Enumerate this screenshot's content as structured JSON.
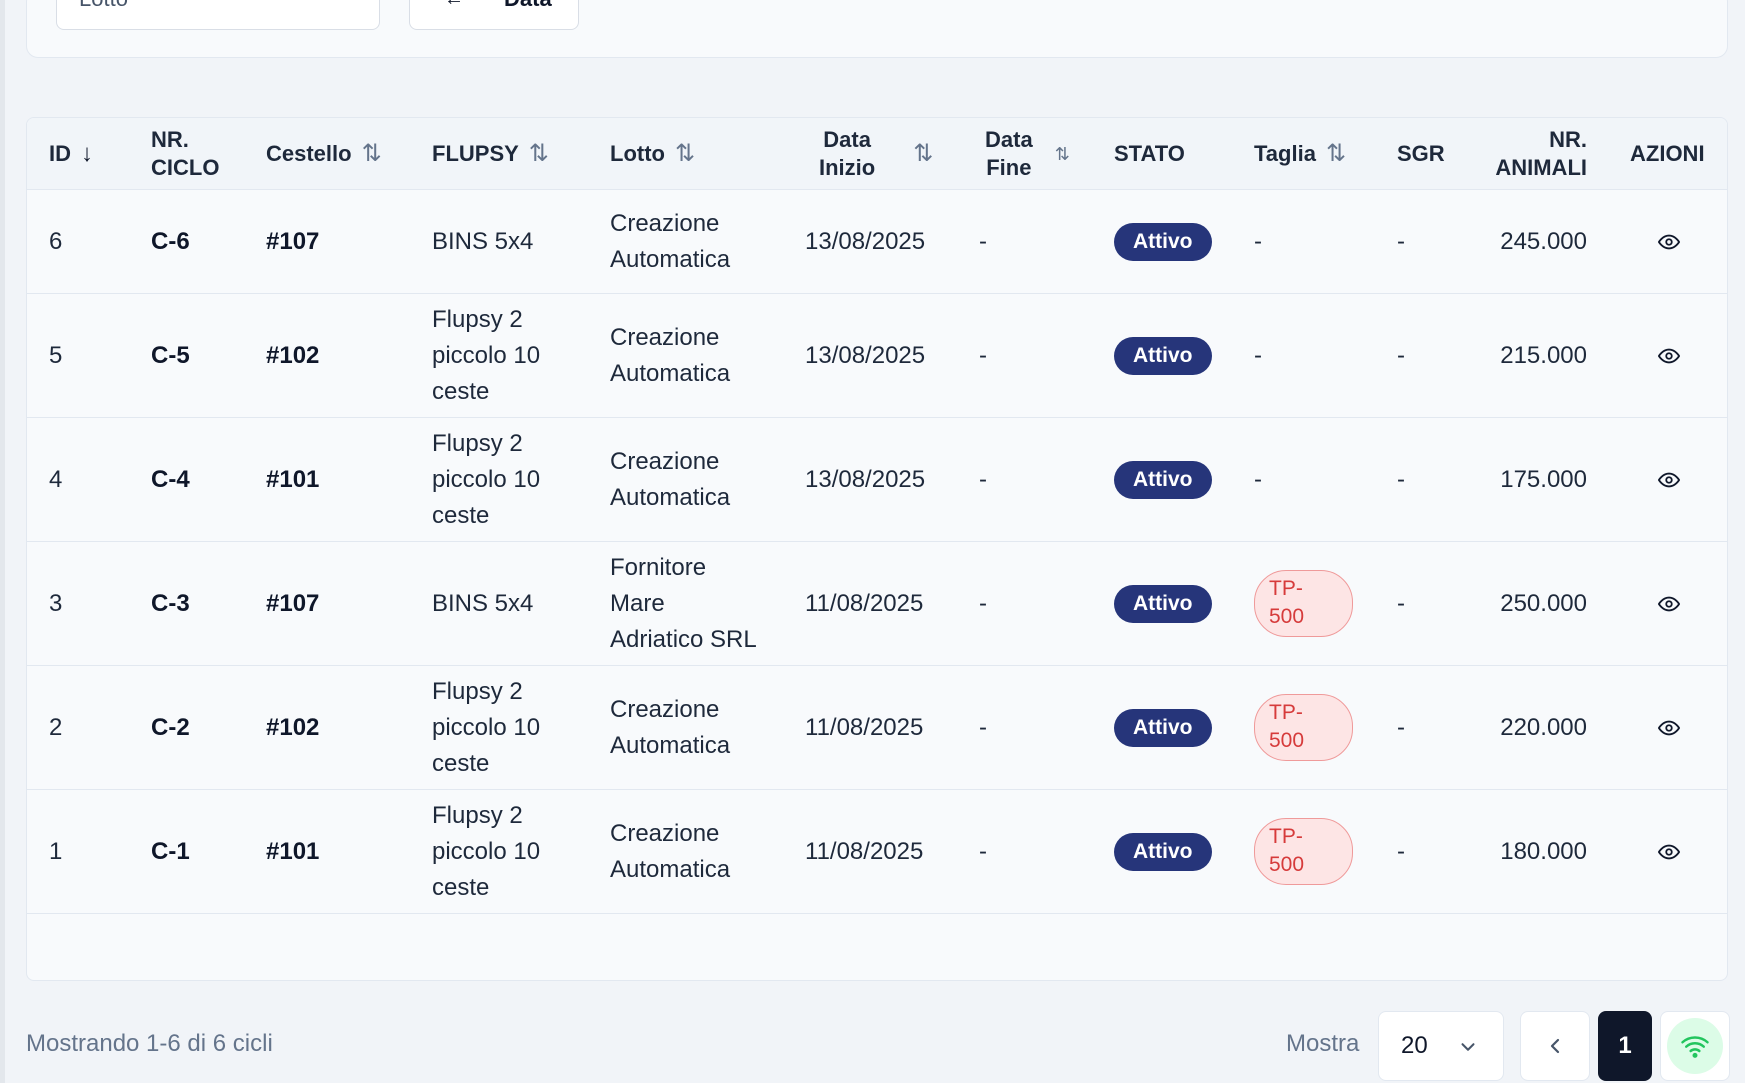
{
  "filters": {
    "lotto_label": "Lotto",
    "data_label": "Data"
  },
  "table": {
    "headers": {
      "id": "ID",
      "ciclo": "NR.\nCICLO",
      "cestello": "Cestello",
      "flupsy": "FLUPSY",
      "lotto": "Lotto",
      "data_inizio": "Data\nInizio",
      "data_fine": "Data\nFine",
      "stato": "STATO",
      "taglia": "Taglia",
      "sgr": "SGR",
      "animali": "NR.\nANIMALI",
      "azioni": "AZIONI"
    },
    "rows": [
      {
        "id": "6",
        "ciclo": "C-6",
        "cestello": "#107",
        "flupsy": "BINS 5x4",
        "lotto": "Creazione\nAutomatica",
        "data_inizio": "13/08/2025",
        "data_fine": "-",
        "stato": "Attivo",
        "taglia": "-",
        "sgr": "-",
        "animali": "245.000"
      },
      {
        "id": "5",
        "ciclo": "C-5",
        "cestello": "#102",
        "flupsy": "Flupsy 2\npiccolo 10\nceste",
        "lotto": "Creazione\nAutomatica",
        "data_inizio": "13/08/2025",
        "data_fine": "-",
        "stato": "Attivo",
        "taglia": "-",
        "sgr": "-",
        "animali": "215.000"
      },
      {
        "id": "4",
        "ciclo": "C-4",
        "cestello": "#101",
        "flupsy": "Flupsy 2\npiccolo 10\nceste",
        "lotto": "Creazione\nAutomatica",
        "data_inizio": "13/08/2025",
        "data_fine": "-",
        "stato": "Attivo",
        "taglia": "-",
        "sgr": "-",
        "animali": "175.000"
      },
      {
        "id": "3",
        "ciclo": "C-3",
        "cestello": "#107",
        "flupsy": "BINS 5x4",
        "lotto": "Fornitore\nMare\nAdriatico SRL",
        "data_inizio": "11/08/2025",
        "data_fine": "-",
        "stato": "Attivo",
        "taglia": "TP-\n500",
        "sgr": "-",
        "animali": "250.000"
      },
      {
        "id": "2",
        "ciclo": "C-2",
        "cestello": "#102",
        "flupsy": "Flupsy 2\npiccolo 10\nceste",
        "lotto": "Creazione\nAutomatica",
        "data_inizio": "11/08/2025",
        "data_fine": "-",
        "stato": "Attivo",
        "taglia": "TP-\n500",
        "sgr": "-",
        "animali": "220.000"
      },
      {
        "id": "1",
        "ciclo": "C-1",
        "cestello": "#101",
        "flupsy": "Flupsy 2\npiccolo 10\nceste",
        "lotto": "Creazione\nAutomatica",
        "data_inizio": "11/08/2025",
        "data_fine": "-",
        "stato": "Attivo",
        "taglia": "TP-\n500",
        "sgr": "-",
        "animali": "180.000"
      }
    ]
  },
  "footer": {
    "summary": "Mostrando 1-6 di 6 cicli",
    "mostra_label": "Mostra",
    "page_size": "20",
    "current_page": "1"
  },
  "icons": {
    "view": "eye-icon",
    "prev": "chevron-left-icon",
    "select": "chevron-down-icon",
    "status": "wifi-icon"
  },
  "colors": {
    "badge_attivo": "#26357a",
    "badge_taglia_bg": "#fde5e5",
    "badge_taglia_text": "#d63b3b",
    "wifi_green": "#22c55e"
  }
}
